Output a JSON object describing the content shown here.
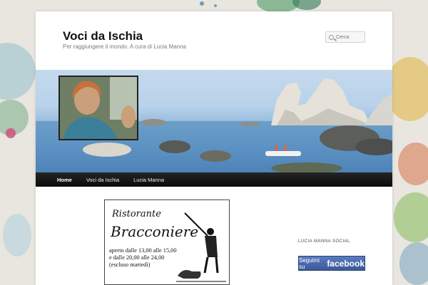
{
  "site": {
    "title": "Voci da Ischia",
    "description": "Per raggiungere il mondo. A cura di Lucia Manna"
  },
  "search": {
    "placeholder": "Cerca",
    "icon": "search-icon"
  },
  "nav": {
    "items": [
      {
        "label": "Home",
        "active": true
      },
      {
        "label": "Voci da Ischia",
        "active": false
      },
      {
        "label": "Lucia Manna",
        "active": false
      }
    ]
  },
  "ad": {
    "line1": "Ristorante",
    "line2": "Bracconiere",
    "hours": [
      "aperto dalle 13,00 alle 15,00",
      "e dalle 20,00 alle 24,00",
      "(escluso martedì)"
    ]
  },
  "sidebar": {
    "widget_title": "LUCIA MANNA SOCIAL",
    "fb_prefix": "Seguimi su",
    "fb_brand": "facebook"
  },
  "colors": {
    "facebook": "#3b5998",
    "nav_bg": "#111111",
    "page_bg": "#ffffff"
  }
}
